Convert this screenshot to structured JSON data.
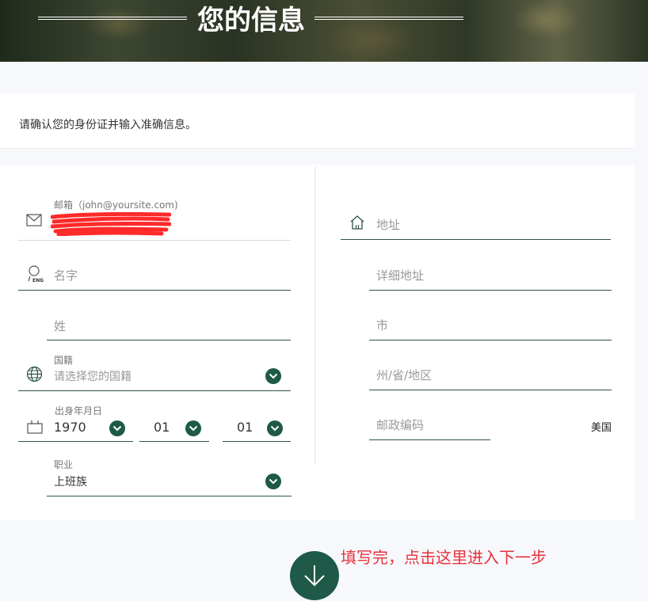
{
  "header": {
    "title": "您的信息"
  },
  "intro": {
    "text": "请确认您的身份证并输入准确信息。"
  },
  "left": {
    "email": {
      "label": "邮箱（john@yoursite.com)",
      "value": ""
    },
    "first_name": {
      "placeholder": "名字"
    },
    "last_name": {
      "placeholder": "姓"
    },
    "nationality": {
      "label": "国籍",
      "placeholder": "请选择您的国籍"
    },
    "birth": {
      "label": "出身年月日",
      "year": "1970",
      "month": "01",
      "day": "01"
    },
    "occupation": {
      "label": "职业",
      "value": "上班族"
    }
  },
  "right": {
    "address": {
      "placeholder": "地址"
    },
    "address_detail": {
      "placeholder": "详细地址"
    },
    "city": {
      "placeholder": "市"
    },
    "state": {
      "placeholder": "州/省/地区"
    },
    "zip": {
      "placeholder": "邮政编码"
    },
    "country": "美国"
  },
  "next": {
    "note": "填写完，点击这里进入下一步"
  },
  "colors": {
    "accent": "#1e5a47",
    "annotation": "#e8323a",
    "redaction": "#ff2a2a"
  }
}
